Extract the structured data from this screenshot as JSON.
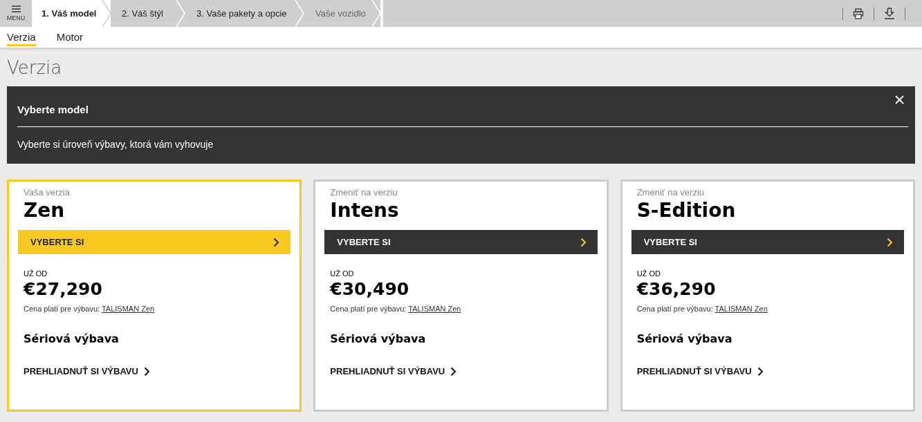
{
  "menu": {
    "label": "MENU"
  },
  "steps": [
    {
      "label": "1. Váš model",
      "selected": true,
      "disabled": false
    },
    {
      "label": "2. Váš štýl",
      "selected": false,
      "disabled": false
    },
    {
      "label": "3. Vaše pakety a opcie",
      "selected": false,
      "disabled": false
    },
    {
      "label": "Vaše vozidlo",
      "selected": false,
      "disabled": true
    }
  ],
  "subtabs": [
    {
      "label": "Verzia",
      "selected": true
    },
    {
      "label": "Motor",
      "selected": false
    }
  ],
  "page_title": "Verzia",
  "banner": {
    "title": "Vyberte model",
    "text": "Vyberte si úroveň výbavy, ktorá vám vyhovuje"
  },
  "cards": [
    {
      "caption": "Vaša verzia",
      "name": "Zen",
      "selected": true,
      "button": "VYBERTE SI",
      "price_label": "UŽ OD",
      "price": "€27,290",
      "note": "Cena platí pre výbavu:",
      "note_link": "TALISMAN Zen",
      "equipment_title": "Sériová výbava",
      "equipment_link": "PREHLIADNUŤ SI VÝBAVU"
    },
    {
      "caption": "Zmeniť na verziu",
      "name": "Intens",
      "selected": false,
      "button": "VYBERTE SI",
      "price_label": "UŽ OD",
      "price": "€30,490",
      "note": "Cena platí pre výbavu:",
      "note_link": "TALISMAN Zen",
      "equipment_title": "Sériová výbava",
      "equipment_link": "PREHLIADNUŤ SI VÝBAVU"
    },
    {
      "caption": "Zmeniť na verziu",
      "name": "S-Edition",
      "selected": false,
      "button": "VYBERTE SI",
      "price_label": "UŽ OD",
      "price": "€36,290",
      "note": "Cena platí pre výbavu:",
      "note_link": "TALISMAN Zen",
      "equipment_title": "Sériová výbava",
      "equipment_link": "PREHLIADNUŤ SI VÝBAVU"
    }
  ]
}
